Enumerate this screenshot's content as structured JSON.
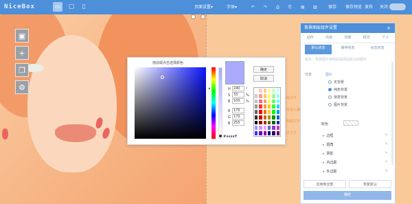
{
  "topbar": {
    "logo": "NiceBox",
    "icons": [
      "desktop-icon",
      "tablet-icon",
      "phone-icon"
    ],
    "items": [
      "页面设置▾",
      "字体▾",
      "↶",
      "↷",
      "⎙",
      "⎘",
      "▤",
      "▥",
      "保存",
      "保存预览",
      "发布",
      "关闭"
    ]
  },
  "left_tools": [
    "image-icon",
    "plus-icon",
    "copy-icon",
    "gear-icon"
  ],
  "color_picker": {
    "hint": "拖动或点击选择颜色",
    "buttons": [
      "确定",
      "取消"
    ],
    "fields": [
      {
        "label": "H",
        "value": "240",
        "unit": "°"
      },
      {
        "label": "S",
        "value": "33",
        "unit": "%"
      },
      {
        "label": "B",
        "value": "100",
        "unit": "%"
      },
      {
        "label": "R",
        "value": "170",
        "unit": ""
      },
      {
        "label": "G",
        "value": "170",
        "unit": ""
      },
      {
        "label": "B",
        "value": "255",
        "unit": ""
      }
    ],
    "hex": "#aaaaff",
    "current_color": "#aaaaff",
    "palette": [
      "#ffffff",
      "#ffcccc",
      "#ffcc99",
      "#ffff99",
      "#ccffcc",
      "#ccffff",
      "#cccccc",
      "#ff9999",
      "#ffcc66",
      "#ffff66",
      "#99ff99",
      "#99ffff",
      "#c0c0c0",
      "#ff6666",
      "#ff9966",
      "#ffff33",
      "#66ff66",
      "#66ffff",
      "#999999",
      "#ff3333",
      "#ff9933",
      "#ffcc00",
      "#33ff33",
      "#33ccff",
      "#666666",
      "#ff0000",
      "#ff6600",
      "#ffcc33",
      "#00ff00",
      "#0099ff",
      "#333333",
      "#cc0000",
      "#cc6600",
      "#999900",
      "#009900",
      "#0066cc",
      "#000000",
      "#990000",
      "#993300",
      "#666600",
      "#006600",
      "#003399",
      "#9999ff",
      "#cc99ff",
      "#ff99ff",
      "#6666cc",
      "#9933cc",
      "#cc33cc",
      "#3333ff",
      "#6600cc",
      "#990099",
      "#000099",
      "#330066",
      "#660066"
    ]
  },
  "panel": {
    "title": "背景图层组件设置",
    "close": "×",
    "tabs": [
      "动作",
      "内容",
      "背景",
      "样式",
      "个人"
    ],
    "subtabs": [
      "默认状态",
      "悬停状态",
      "点击状态"
    ],
    "note": "提示：背景图片使用的是网站默认的图片",
    "bg_label": "背景",
    "bg_value": "图片",
    "radios": [
      {
        "label": "无背景",
        "on": false
      },
      {
        "label": "纯色背景",
        "on": true
      },
      {
        "label": "渐变背景",
        "on": false
      },
      {
        "label": "图片背景",
        "on": false
      }
    ],
    "color_label": "颜色",
    "accordions": [
      "边框",
      "圆角",
      "阴影",
      "内边距",
      "外边距"
    ],
    "footer_buttons": [
      "应用到全部",
      "恢复默认"
    ],
    "save": "确定"
  },
  "stage_side_texts": [
    "标题文字",
    "点击进入编辑",
    "副标题文字",
    "描述文字"
  ]
}
